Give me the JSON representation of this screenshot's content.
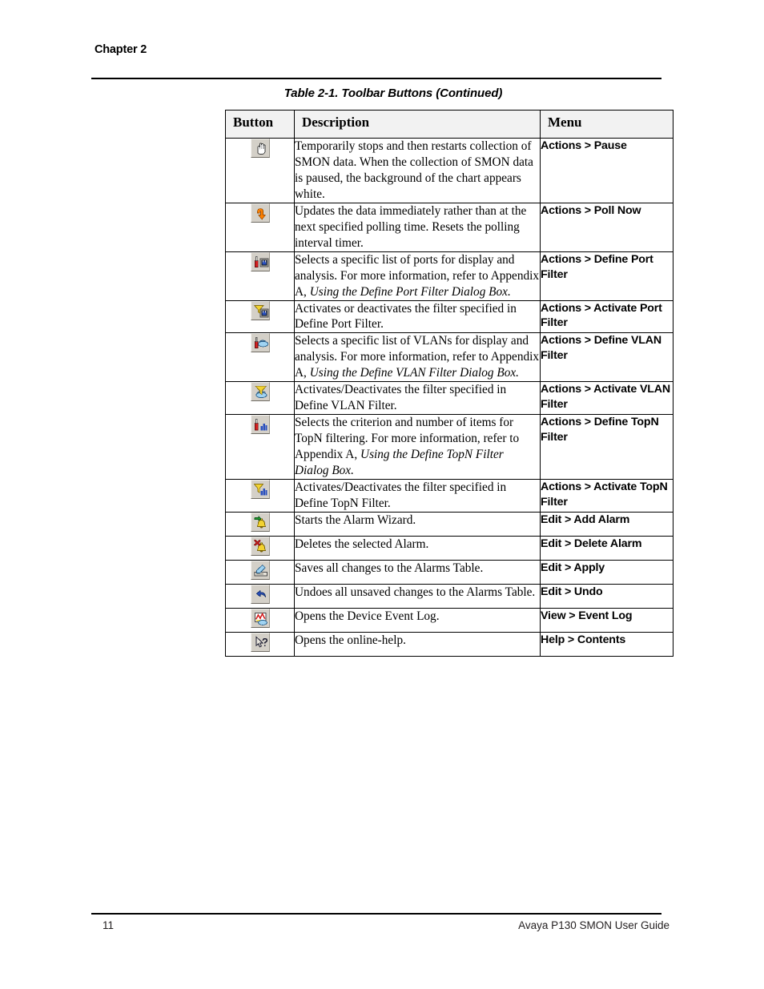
{
  "header": {
    "chapter": "Chapter 2"
  },
  "table": {
    "caption": "Table 2-1.  Toolbar Buttons (Continued)",
    "columns": {
      "button": "Button",
      "description": "Description",
      "menu": "Menu"
    },
    "rows": [
      {
        "icon": "hand-pause-icon",
        "description": "Temporarily stops and then restarts collection of SMON data. When the collection of SMON data is paused, the background of the chart appears white.",
        "description_italic": "",
        "menu": "Actions > Pause"
      },
      {
        "icon": "poll-now-arrow-icon",
        "description": "Updates the data immediately rather than at the next specified polling time. Resets the polling interval timer.",
        "description_italic": "",
        "menu": "Actions > Poll Now"
      },
      {
        "icon": "define-port-filter-icon",
        "description": "Selects a specific list of ports for display and analysis. For more information, refer to Appendix A, ",
        "description_italic": "Using the Define Port Filter Dialog Box.",
        "menu": "Actions > Define Port Filter"
      },
      {
        "icon": "activate-port-filter-icon",
        "description": "Activates or deactivates the filter specified in Define Port Filter.",
        "description_italic": "",
        "menu": "Actions > Activate Port Filter"
      },
      {
        "icon": "define-vlan-filter-icon",
        "description": "Selects a specific list of VLANs for display and analysis. For more information, refer to Appendix A, ",
        "description_italic": "Using the Define VLAN Filter Dialog Box.",
        "menu": "Actions > Define VLAN Filter"
      },
      {
        "icon": "activate-vlan-filter-icon",
        "description": "Activates/Deactivates the filter specified in Define VLAN Filter.",
        "description_italic": "",
        "menu": "Actions > Activate VLAN Filter"
      },
      {
        "icon": "define-topn-filter-icon",
        "description": "Selects the criterion and number of items for TopN filtering. For more information, refer to Appendix A, ",
        "description_italic": "Using the Define TopN Filter Dialog Box.",
        "menu": "Actions > Define TopN Filter"
      },
      {
        "icon": "activate-topn-filter-icon",
        "description": "Activates/Deactivates the filter specified in Define TopN Filter.",
        "description_italic": "",
        "menu": "Actions > Activate TopN Filter"
      },
      {
        "icon": "add-alarm-bell-icon",
        "description": "Starts the Alarm Wizard.",
        "description_italic": "",
        "menu": "Edit > Add Alarm"
      },
      {
        "icon": "delete-alarm-bell-icon",
        "description": "Deletes the selected Alarm.",
        "description_italic": "",
        "menu": "Edit > Delete Alarm"
      },
      {
        "icon": "apply-save-icon",
        "description": "Saves all changes to the Alarms Table.",
        "description_italic": "",
        "menu": "Edit > Apply"
      },
      {
        "icon": "undo-arrow-icon",
        "description": "Undoes all unsaved changes to the Alarms Table.",
        "description_italic": "",
        "menu": "Edit > Undo"
      },
      {
        "icon": "event-log-icon",
        "description": "Opens the Device Event Log.",
        "description_italic": "",
        "menu": "View > Event Log"
      },
      {
        "icon": "help-pointer-icon",
        "description": "Opens the online-help.",
        "description_italic": "",
        "menu": "Help > Contents"
      }
    ]
  },
  "footer": {
    "page_number": "11",
    "document_title": "Avaya P130 SMON User Guide"
  },
  "colors": {
    "rule": "#000000",
    "header_fill": "#f2f2f2",
    "button_face": "#d4d0c8",
    "orange": "#ff8000",
    "red": "#d42020",
    "yellow": "#f2d230",
    "blue": "#2a4fbe",
    "green": "#1f9c30"
  }
}
